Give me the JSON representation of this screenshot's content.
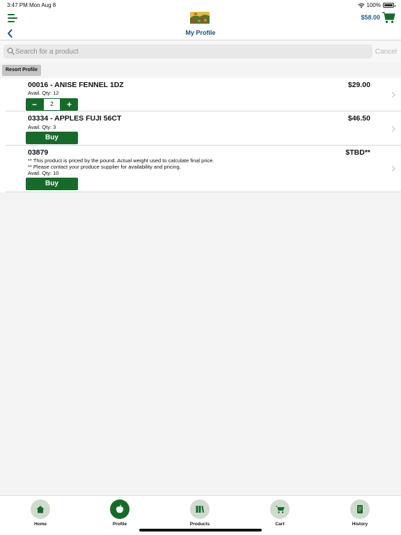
{
  "status_bar": {
    "time": "3:47 PM",
    "date": "Mon Aug 8",
    "battery": "100%",
    "battery_level": 1.0
  },
  "header": {
    "cart_total": "$58.00",
    "menu_icon": "hamburger-icon",
    "cart_icon": "shopping-cart-icon",
    "logo": "farm-produce-logo"
  },
  "nav": {
    "title": "My Profile",
    "back_icon": "chevron-left-icon"
  },
  "search": {
    "placeholder": "Search for a product",
    "value": "",
    "cancel_label": "Cancel"
  },
  "resort_label": "Resort Profile",
  "products": [
    {
      "title": "00016 - ANISE FENNEL 1DZ",
      "price": "$29.00",
      "info": [
        "Avail. Qty: 12"
      ],
      "quantity": "2",
      "action": "stepper"
    },
    {
      "title": "03334 - APPLES FUJI 56CT",
      "price": "$46.50",
      "info": [
        "Avail. Qty: 3"
      ],
      "buy_label": "Buy",
      "action": "buy"
    },
    {
      "title": "03879",
      "price": "$TBD**",
      "info": [
        "** This product is priced by the pound.  Actual weight used to calculate final price.",
        "** Please contact your produce supplier for availability and pricing.",
        "Avail. Qty: 10"
      ],
      "buy_label": "Buy",
      "action": "buy"
    }
  ],
  "tabs": [
    {
      "label": "Home",
      "icon": "home-icon",
      "active": false
    },
    {
      "label": "Profile",
      "icon": "apple-icon",
      "active": true
    },
    {
      "label": "Products",
      "icon": "books-icon",
      "active": false
    },
    {
      "label": "Cart",
      "icon": "cart-icon",
      "active": false
    },
    {
      "label": "History",
      "icon": "document-icon",
      "active": false
    }
  ],
  "colors": {
    "brand_green": "#166b2a",
    "title_blue": "#1c4f7a",
    "tab_circle": "#cfdccd"
  }
}
